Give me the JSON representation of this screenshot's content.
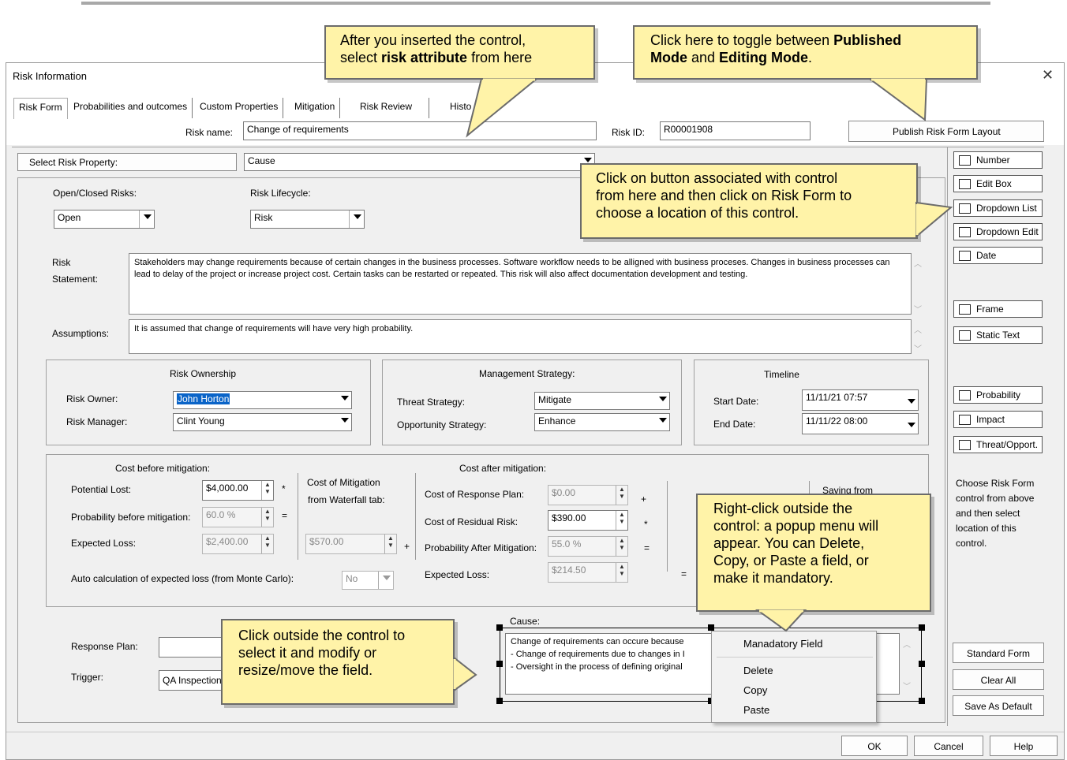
{
  "window": {
    "title": "Risk Information",
    "close_glyph": "✕"
  },
  "tabs": [
    "Risk Form",
    "Probabilities and outcomes",
    "Custom Properties",
    "Mitigation",
    "Risk Review",
    "Histo"
  ],
  "header": {
    "risk_name_label": "Risk name:",
    "risk_name_value": "Change of requirements",
    "risk_id_label": "Risk ID:",
    "risk_id_value": "R00001908",
    "publish_button": "Publish Risk Form Layout"
  },
  "select_property": {
    "label": "Select Risk Property:",
    "value": "Cause"
  },
  "form": {
    "open_closed_label": "Open/Closed Risks:",
    "open_closed_value": "Open",
    "lifecycle_label": "Risk Lifecycle:",
    "lifecycle_value": "Risk",
    "risk_label": "Risk",
    "statement_label": "Statement:",
    "statement_text": "Stakeholders may change requirements because of certain changes in the business processes. Software workflow needs to be alligned with business proceses. Changes in business processes can lead to delay of the project or increase project cost. Certain tasks can be restarted or repeated. This risk will also affect documentation development and testing.",
    "assumptions_label": "Assumptions:",
    "assumptions_text": "It is assumed that change of requirements will have very high probability.",
    "ownership": {
      "title": "Risk Ownership",
      "owner_label": "Risk Owner:",
      "owner_value": "John Horton",
      "manager_label": "Risk Manager:",
      "manager_value": "Clint Young"
    },
    "strategy": {
      "title": "Management Strategy:",
      "threat_label": "Threat Strategy:",
      "threat_value": "Mitigate",
      "opp_label": "Opportunity Strategy:",
      "opp_value": "Enhance"
    },
    "timeline": {
      "title": "Timeline",
      "start_label": "Start Date:",
      "start_value": "11/11/21 07:57",
      "end_label": "End Date:",
      "end_value": "11/11/22 08:00"
    },
    "cost": {
      "before_title": "Cost before mitigation:",
      "potential_label": "Potential Lost:",
      "potential_value": "$4,000.00",
      "prob_before_label": "Probability before mitigation:",
      "prob_before_value": "60.0 %",
      "expected_label": "Expected Loss:",
      "expected_value": "$2,400.00",
      "mitigation_cost_label1": "Cost of Mitigation",
      "mitigation_cost_label2": "from Waterfall tab:",
      "mitigation_cost_value": "$570.00",
      "after_title": "Cost after mitigation:",
      "response_cost_label": "Cost of Response Plan:",
      "response_cost_value": "$0.00",
      "residual_label": "Cost of Residual Risk:",
      "residual_value": "$390.00",
      "prob_after_label": "Probability After Mitigation:",
      "prob_after_value": "55.0 %",
      "expected_after_label": "Expected Loss:",
      "expected_after_value": "$214.50",
      "saving_label": "Saving from",
      "auto_calc_label": "Auto calculation of expected loss (from Monte Carlo):",
      "auto_calc_value": "No",
      "ops": {
        "times": "*",
        "equals": "=",
        "plus": "+"
      }
    },
    "response_plan_label": "Response Plan:",
    "trigger_label": "Trigger:",
    "trigger_value": "QA Inspection",
    "cause_label": "Cause:",
    "cause_lines": [
      "Change of requirements can occure because",
      "- Change of requirements due to changes in I",
      "- Oversight in the process of defining original"
    ]
  },
  "tools": [
    "Number",
    "Edit Box",
    "Dropdown List",
    "Dropdown Edit",
    "Date",
    "Frame",
    "Static Text",
    "Probability",
    "Impact",
    "Threat/Opport."
  ],
  "tool_hint": [
    "Choose Risk Form",
    "control from above",
    "and then select",
    "location of this",
    "control."
  ],
  "side_buttons": [
    "Standard Form",
    "Clear All",
    "Save As Default"
  ],
  "footer_buttons": [
    "OK",
    "Cancel",
    "Help"
  ],
  "context_menu": [
    "Manadatory Field",
    "Delete",
    "Copy",
    "Paste"
  ],
  "callouts": {
    "c1": {
      "line1": "After you inserted the control,",
      "line2_pre": "select ",
      "line2_bold": "risk attribute",
      "line2_post": " from here"
    },
    "c2": {
      "line1_pre": "Click here to toggle between ",
      "line1_bold": "Published",
      "line2_bold1": "Mode",
      "line2_mid": " and ",
      "line2_bold2": "Editing Mode",
      "line2_post": "."
    },
    "c3": [
      "Click on button associated with control",
      "from here and then click on Risk Form to",
      "choose a location of this control."
    ],
    "c4": [
      "Right-click outside the",
      "control: a popup menu will",
      "appear. You can Delete,",
      "Copy, or Paste a field, or",
      "make it mandatory."
    ],
    "c5": [
      "Click outside the control to",
      "select it and modify or",
      "resize/move the field."
    ]
  }
}
